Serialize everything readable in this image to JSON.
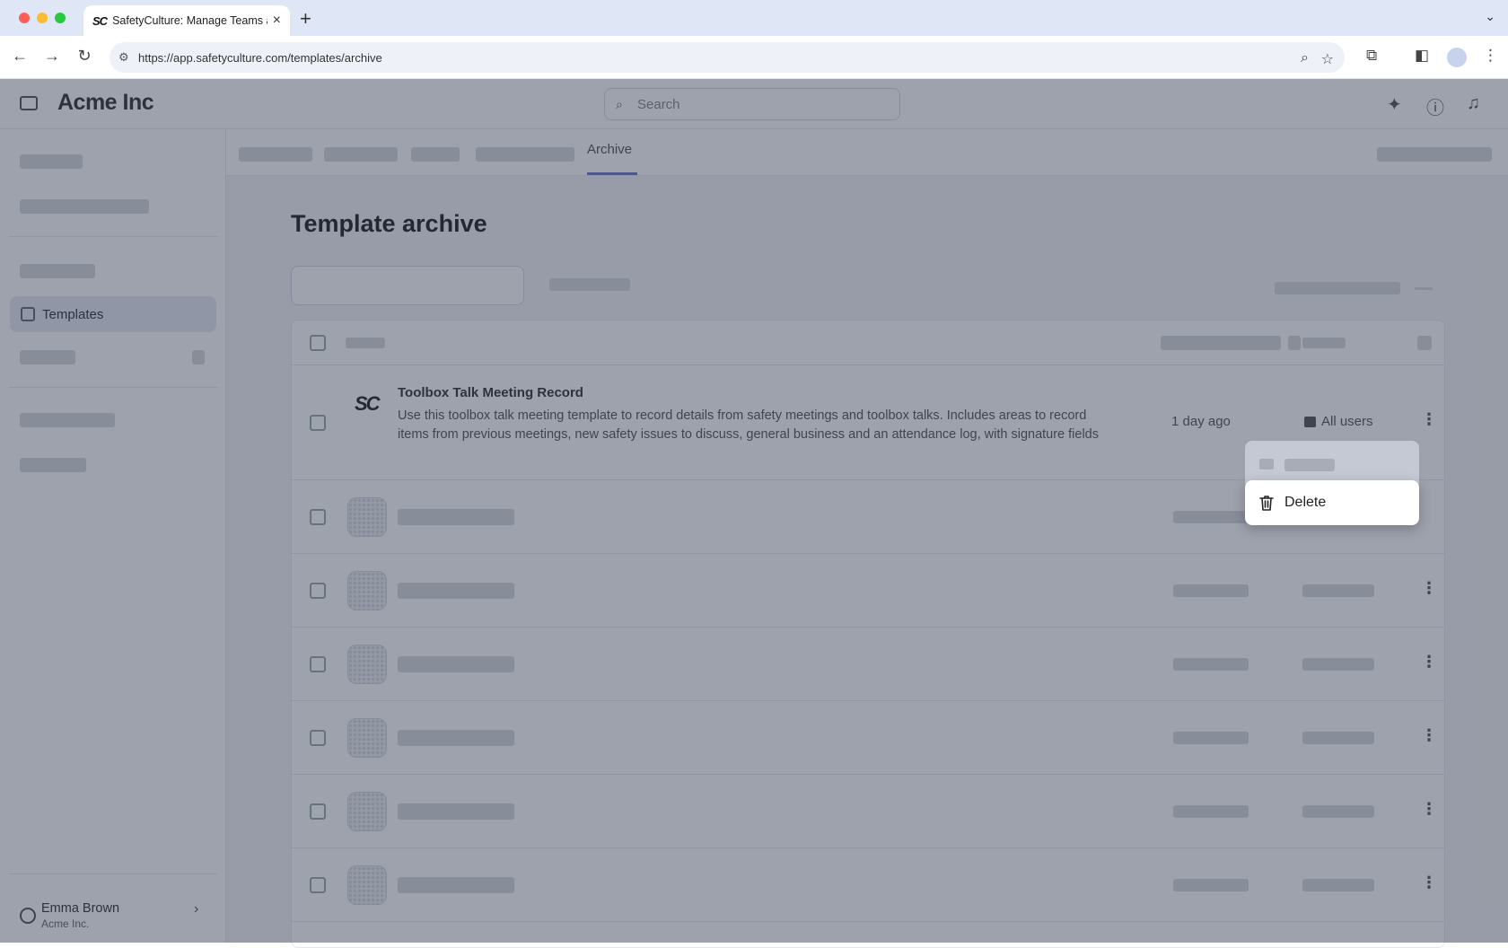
{
  "browser": {
    "tab_title": "SafetyCulture: Manage Teams and...",
    "tab_favicon": "SC",
    "url": "https://app.safetyculture.com/templates/archive"
  },
  "app": {
    "logo": "Acme Inc",
    "search_placeholder": "Search"
  },
  "sidebar": {
    "active_item": "Templates",
    "user_name": "Emma Brown",
    "user_org": "Acme Inc."
  },
  "subnav": {
    "active_tab": "Archive"
  },
  "page": {
    "title": "Template archive"
  },
  "template": {
    "logo": "SC",
    "name": "Toolbox Talk Meeting Record",
    "description": "Use this toolbox talk meeting template to record details from safety meetings and toolbox talks. Includes areas to record items from previous meetings, new safety issues to discuss, general business and an attendance log, with signature fields",
    "modified": "1 day ago",
    "access": "All users"
  },
  "context_menu": {
    "delete_label": "Delete"
  },
  "colors": {
    "accent": "#6b77c9",
    "overlay": "#283046"
  }
}
